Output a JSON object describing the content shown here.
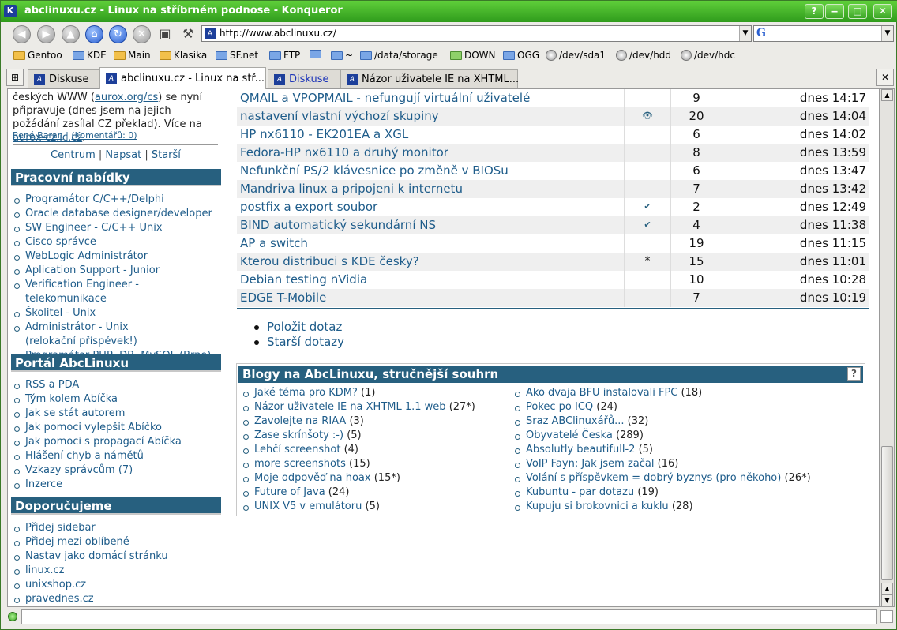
{
  "window": {
    "title": "abclinuxu.cz - Linux na stříbrném podnose - Konqueror",
    "buttons": [
      "?",
      "‒",
      "□",
      "✕"
    ]
  },
  "toolbar": {
    "url": "http://www.abclinuxu.cz/",
    "search_engine_glyph": "G"
  },
  "bookmarks": [
    {
      "label": "Gentoo",
      "icon": "folder-icon"
    },
    {
      "label": "KDE",
      "icon": "kde-icon"
    },
    {
      "label": "Main",
      "icon": "folder-icon"
    },
    {
      "label": "Klasika",
      "icon": "folder-icon"
    },
    {
      "label": "SF.net",
      "icon": "folder-icon"
    },
    {
      "label": "FTP",
      "icon": "folder-icon"
    },
    {
      "label": "",
      "icon": "folder-icon"
    },
    {
      "label": "~",
      "icon": "folder-icon"
    },
    {
      "label": "/data/storage",
      "icon": "folder-icon"
    },
    {
      "label": "DOWN",
      "icon": "folder-icon"
    },
    {
      "label": "OGG",
      "icon": "folder-icon"
    },
    {
      "label": "/dev/sda1",
      "icon": "disk-icon"
    },
    {
      "label": "/dev/hdd",
      "icon": "disk-icon"
    },
    {
      "label": "/dev/hdc",
      "icon": "disk-icon"
    }
  ],
  "tabs": [
    {
      "label": "Diskuse"
    },
    {
      "label": "abclinuxu.cz - Linux na stř..."
    },
    {
      "label": "Diskuse"
    },
    {
      "label": "Názor uživatele IE na XHTML..."
    }
  ],
  "sidebar": {
    "intro_1": "českých WWW (",
    "intro_link1": "aurox.org/cs",
    "intro_2": ") se nyní připravuje (dnes jsem na jejich požádání zasílal CZ překlad). Více na ",
    "intro_link2": "aurox-cz.ic.cz",
    "intro_3": ".",
    "author": "René Baran",
    "comments": "(Komentářů: 0)",
    "nav": [
      "Centrum",
      "Napsat",
      "Starší"
    ],
    "jobs_title": "Pracovní nabídky",
    "jobs": [
      "Programátor C/C++/Delphi",
      "Oracle database designer/developer",
      "SW Engineer - C/C++ Unix",
      "Cisco správce",
      "WebLogic Administrátor",
      "Aplication Support - Junior",
      "Verification Engineer - telekomunikace",
      "Školitel - Unix",
      "Administrátor - Unix (relokační příspěvek!)",
      "Programátor PHP, DB, MySQL (Brno)"
    ],
    "portal_title": "Portál AbcLinuxu",
    "portal": [
      "RSS a PDA",
      "Tým kolem Abíčka",
      "Jak se stát autorem",
      "Jak pomoci vylepšit Abíčko",
      "Jak pomoci s propagací Abíčka",
      "Hlášení chyb a námětů",
      "Vzkazy správcům (7)",
      "Inzerce"
    ],
    "recommend_title": "Doporučujeme",
    "recommend": [
      "Přidej sidebar",
      "Přidej mezi oblíbené",
      "Nastav jako domácí stránku",
      "linux.cz",
      "unixshop.cz",
      "pravednes.cz"
    ]
  },
  "questions": [
    {
      "title": "QMAIL a VPOPMAIL - nefungují virtuální uživatelé",
      "flag": "",
      "count": "9",
      "date": "dnes 14:17"
    },
    {
      "title": "nastavení vlastní výchozí skupiny",
      "flag": "👁",
      "count": "20",
      "date": "dnes 14:04"
    },
    {
      "title": "HP nx6110 - EK201EA a XGL",
      "flag": "",
      "count": "6",
      "date": "dnes 14:02"
    },
    {
      "title": "Fedora-HP nx6110 a druhý monitor",
      "flag": "",
      "count": "8",
      "date": "dnes 13:59"
    },
    {
      "title": "Nefunkční PS/2 klávesnice po změně v BIOSu",
      "flag": "",
      "count": "6",
      "date": "dnes 13:47"
    },
    {
      "title": "Mandriva linux a pripojeni k internetu",
      "flag": "",
      "count": "7",
      "date": "dnes 13:42"
    },
    {
      "title": "postfix a export soubor",
      "flag": "✔",
      "count": "2",
      "date": "dnes 12:49"
    },
    {
      "title": "BIND automatický sekundární NS",
      "flag": "✔",
      "count": "4",
      "date": "dnes 11:38"
    },
    {
      "title": "AP a switch",
      "flag": "",
      "count": "19",
      "date": "dnes 11:15"
    },
    {
      "title": "Kterou distribuci s KDE česky?",
      "flag": "*",
      "count": "15",
      "date": "dnes 11:01"
    },
    {
      "title": "Debian testing nVidia",
      "flag": "",
      "count": "10",
      "date": "dnes 10:28"
    },
    {
      "title": "EDGE T-Mobile",
      "flag": "",
      "count": "7",
      "date": "dnes 10:19"
    }
  ],
  "question_links": [
    "Položit dotaz",
    "Starší dotazy"
  ],
  "blogs": {
    "title": "Blogy na AbcLinuxu, stručnější souhrn",
    "help": "?",
    "left": [
      {
        "title": "Jaké téma pro KDM?",
        "count": "(1)"
      },
      {
        "title": "Názor uživatele IE na XHTML 1.1 web",
        "count": "(27*)"
      },
      {
        "title": "Zavolejte na RIAA",
        "count": "(3)"
      },
      {
        "title": "Zase skrínšoty :-)",
        "count": "(5)"
      },
      {
        "title": "Lehčí screenshot",
        "count": "(4)"
      },
      {
        "title": "more screenshots",
        "count": "(15)"
      },
      {
        "title": "Moje odpověď na hoax",
        "count": "(15*)"
      },
      {
        "title": "Future of Java",
        "count": "(24)"
      },
      {
        "title": "UNIX V5 v emulátoru",
        "count": "(5)"
      }
    ],
    "right": [
      {
        "title": "Ako dvaja BFU instalovali FPC",
        "count": "(18)"
      },
      {
        "title": "Pokec po ICQ",
        "count": "(24)"
      },
      {
        "title": "Sraz ABClinuxářů...",
        "count": "(32)"
      },
      {
        "title": "Obyvatelé Česka",
        "count": "(289)"
      },
      {
        "title": "Absolutly beautifull-2",
        "count": "(5)"
      },
      {
        "title": "VoIP Fayn: Jak jsem začal",
        "count": "(16)"
      },
      {
        "title": "Volání s příspěvkem = dobrý byznys (pro někoho)",
        "count": "(26*)"
      },
      {
        "title": "Kubuntu - par dotazu",
        "count": "(19)"
      },
      {
        "title": "Kupuju si brokovnici a kuklu",
        "count": "(28)"
      }
    ]
  }
}
